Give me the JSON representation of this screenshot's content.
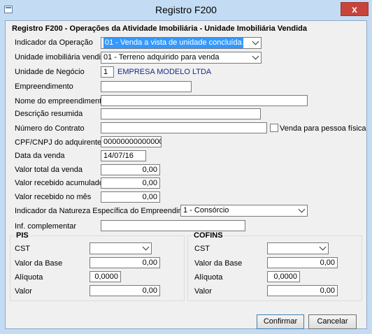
{
  "window": {
    "title": "Registro F200",
    "close_glyph": "x"
  },
  "section": {
    "title": "Registro F200 - Operações da Atividade Imobiliária - Unidade Imobiliária Vendida"
  },
  "fields": {
    "indicador_operacao": {
      "label": "Indicador da Operação",
      "value": "01 - Venda a vista de unidade concluída"
    },
    "unidade_imobiliaria": {
      "label": "Unidade imobiliária vendida",
      "value": "01 - Terreno adquirido para venda"
    },
    "unidade_negocio": {
      "label": "Unidade de Negócio",
      "code": "1",
      "name": "EMPRESA MODELO LTDA"
    },
    "empreendimento": {
      "label": "Empreendimento",
      "value": ""
    },
    "nome_empreendimento": {
      "label": "Nome do empreendimento",
      "value": ""
    },
    "descricao_resumida": {
      "label": "Descrição resumida",
      "value": ""
    },
    "numero_contrato": {
      "label": "Número do Contrato",
      "value": ""
    },
    "venda_pessoa_fisica": {
      "label": "Venda para pessoa física",
      "checked": false
    },
    "cpf_cnpj": {
      "label": "CPF/CNPJ do adquirente",
      "value": "00000000000000"
    },
    "data_venda": {
      "label": "Data da venda",
      "value": "14/07/16"
    },
    "valor_total": {
      "label": "Valor total da venda",
      "value": "0,00"
    },
    "valor_recebido_acum": {
      "label": "Valor recebido acumulado",
      "value": "0,00"
    },
    "valor_recebido_mes": {
      "label": "Valor recebido no mês",
      "value": "0,00"
    },
    "indicador_natureza": {
      "label": "Indicador da Natureza Específica do Empreendimento",
      "value": "1 - Consórcio"
    },
    "inf_complementar": {
      "label": "Inf. complementar",
      "value": ""
    }
  },
  "pis": {
    "legend": "PIS",
    "cst_label": "CST",
    "cst_value": "",
    "base_label": "Valor da Base",
    "base_value": "0,00",
    "aliquota_label": "Alíquota",
    "aliquota_value": "0,0000",
    "valor_label": "Valor",
    "valor_value": "0,00"
  },
  "cofins": {
    "legend": "COFINS",
    "cst_label": "CST",
    "cst_value": "",
    "base_label": "Valor da Base",
    "base_value": "0,00",
    "aliquota_label": "Alíquota",
    "aliquota_value": "0,0000",
    "valor_label": "Valor",
    "valor_value": "0,00"
  },
  "buttons": {
    "confirm": "Confirmar",
    "cancel": "Cancelar"
  },
  "colors": {
    "titlebar": "#c3dcf3",
    "close": "#c7443a",
    "selection": "#3399ff"
  }
}
